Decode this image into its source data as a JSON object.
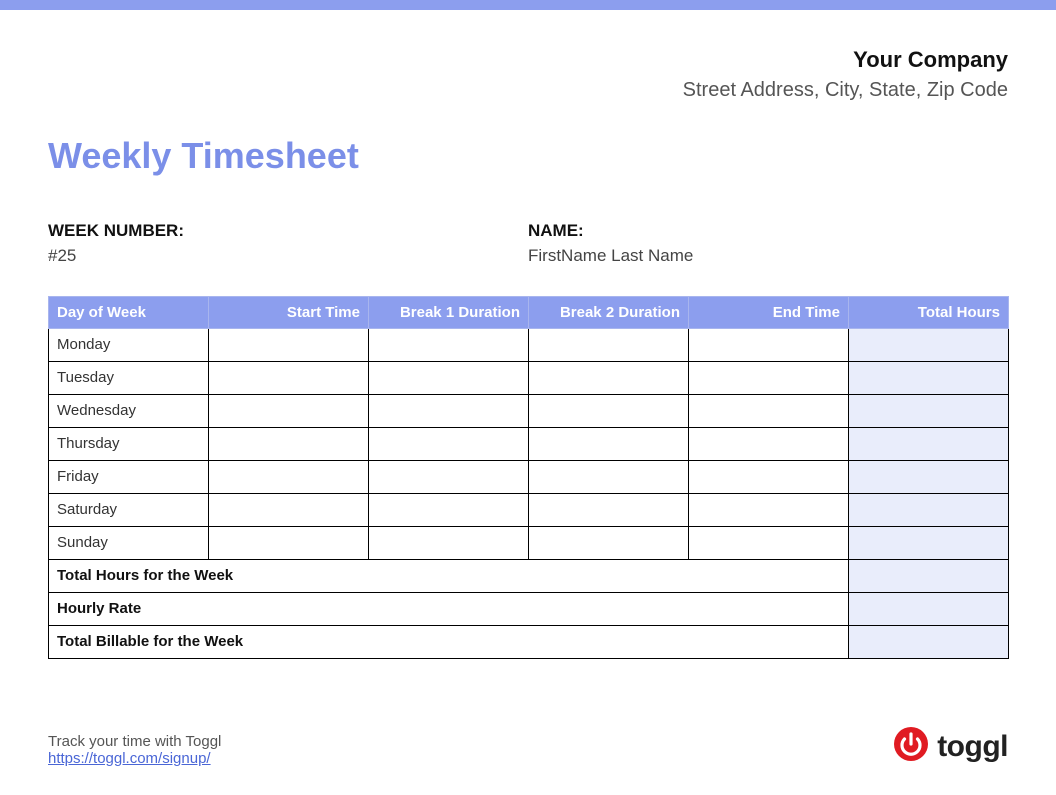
{
  "header": {
    "company_name": "Your Company",
    "company_address": "Street Address, City, State, Zip Code"
  },
  "title": "Weekly Timesheet",
  "meta": {
    "week_label": "WEEK NUMBER:",
    "week_value": "#25",
    "name_label": "NAME:",
    "name_value": "FirstName Last Name"
  },
  "table": {
    "headers": {
      "day": "Day of Week",
      "start": "Start Time",
      "break1": "Break 1 Duration",
      "break2": "Break 2 Duration",
      "end": "End Time",
      "total": "Total Hours"
    },
    "rows": [
      {
        "day": "Monday",
        "start": "",
        "break1": "",
        "break2": "",
        "end": "",
        "total": ""
      },
      {
        "day": "Tuesday",
        "start": "",
        "break1": "",
        "break2": "",
        "end": "",
        "total": ""
      },
      {
        "day": "Wednesday",
        "start": "",
        "break1": "",
        "break2": "",
        "end": "",
        "total": ""
      },
      {
        "day": "Thursday",
        "start": "",
        "break1": "",
        "break2": "",
        "end": "",
        "total": ""
      },
      {
        "day": "Friday",
        "start": "",
        "break1": "",
        "break2": "",
        "end": "",
        "total": ""
      },
      {
        "day": "Saturday",
        "start": "",
        "break1": "",
        "break2": "",
        "end": "",
        "total": ""
      },
      {
        "day": "Sunday",
        "start": "",
        "break1": "",
        "break2": "",
        "end": "",
        "total": ""
      }
    ],
    "summary": {
      "total_hours_label": "Total Hours for the Week",
      "total_hours_value": "",
      "hourly_rate_label": "Hourly Rate",
      "hourly_rate_value": "",
      "total_billable_label": "Total Billable for the Week",
      "total_billable_value": ""
    }
  },
  "footer": {
    "tagline": "Track your time with Toggl",
    "link_text": "https://toggl.com/signup/",
    "logo_text": "toggl"
  },
  "colors": {
    "accent": "#8c9eee",
    "title": "#7b8fe8",
    "logo_red": "#e01b22"
  }
}
